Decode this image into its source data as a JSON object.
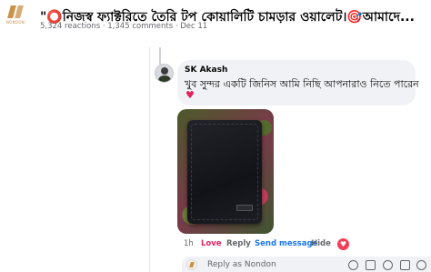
{
  "header": {
    "title": "\"⭕নিজস্ব ফ্যাক্টরিতে তৈরি টপ কোয়ালিটি চামড়ার ওয়ালেট।🎯আমাদে...",
    "reactions": "5,324 reactions",
    "comments": "1,345 comments",
    "date": "Dec 11",
    "separator": " · ",
    "logo_word": "NONDON"
  },
  "comment": {
    "author": "SK Akash",
    "text": "খুব সুন্দর একটি জিনিস আমি নিছি আপনারাও নিতে পারেন",
    "emoji": "♥",
    "time": "1h",
    "love_label": "Love",
    "reply_label": "Reply",
    "send_label": "Send message",
    "hide_label": "Hide",
    "reaction": "♥"
  },
  "composer": {
    "placeholder": "Reply as Nondon"
  },
  "colors": {
    "love": "#e0245e",
    "link": "#1877f2",
    "bubble": "#f0f2f5"
  }
}
